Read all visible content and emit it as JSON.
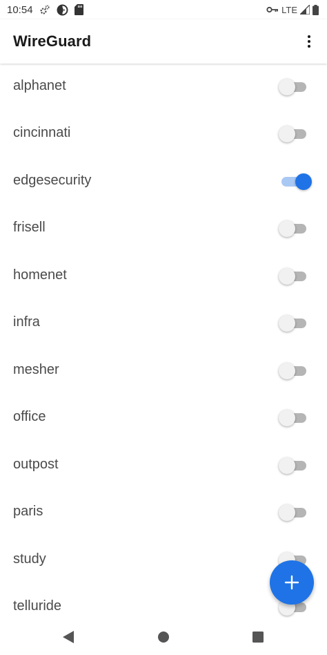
{
  "status_bar": {
    "time": "10:54",
    "network_type": "LTE",
    "icons": [
      "gear-icon",
      "data-saver-icon",
      "sd-card-icon",
      "vpn-key-icon",
      "signal-icon",
      "battery-icon"
    ]
  },
  "app_bar": {
    "title": "WireGuard",
    "menu_icon": "more-vert-icon"
  },
  "tunnels": [
    {
      "name": "alphanet",
      "enabled": false
    },
    {
      "name": "cincinnati",
      "enabled": false
    },
    {
      "name": "edgesecurity",
      "enabled": true
    },
    {
      "name": "frisell",
      "enabled": false
    },
    {
      "name": "homenet",
      "enabled": false
    },
    {
      "name": "infra",
      "enabled": false
    },
    {
      "name": "mesher",
      "enabled": false
    },
    {
      "name": "office",
      "enabled": false
    },
    {
      "name": "outpost",
      "enabled": false
    },
    {
      "name": "paris",
      "enabled": false
    },
    {
      "name": "study",
      "enabled": false
    },
    {
      "name": "telluride",
      "enabled": false
    }
  ],
  "fab": {
    "icon": "add-icon"
  },
  "nav_bar": {
    "icons": [
      "back-icon",
      "home-icon",
      "recents-icon"
    ]
  },
  "colors": {
    "accent": "#1f73e6",
    "switch_on_track": "#a9c8f3",
    "switch_off_track": "#b5b5b5",
    "switch_off_thumb": "#f1f1f1",
    "text": "#4a4a4a"
  }
}
